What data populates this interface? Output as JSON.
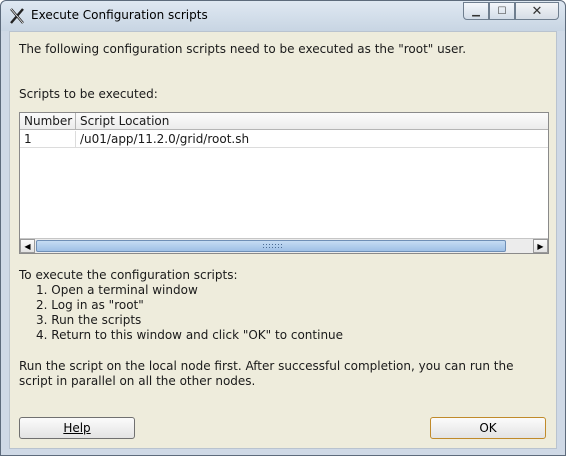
{
  "window": {
    "title": "Execute Configuration scripts",
    "app_icon": "x-icon"
  },
  "content": {
    "intro": "The following configuration scripts need to be executed as the \"root\" user.",
    "scripts_label": "Scripts to be executed:",
    "table": {
      "columns": [
        "Number",
        "Script Location"
      ],
      "rows": [
        {
          "number": "1",
          "location": "/u01/app/11.2.0/grid/root.sh"
        }
      ]
    },
    "instructions": {
      "heading": "To execute the configuration scripts:",
      "steps": [
        "1. Open a terminal window",
        "2. Log in as \"root\"",
        "3. Run the scripts",
        "4. Return to this window and click \"OK\" to continue"
      ]
    },
    "note": "Run the script on the local node first. After successful completion, you can run the script in parallel on all the other nodes."
  },
  "buttons": {
    "help": "Help",
    "ok": "OK"
  }
}
